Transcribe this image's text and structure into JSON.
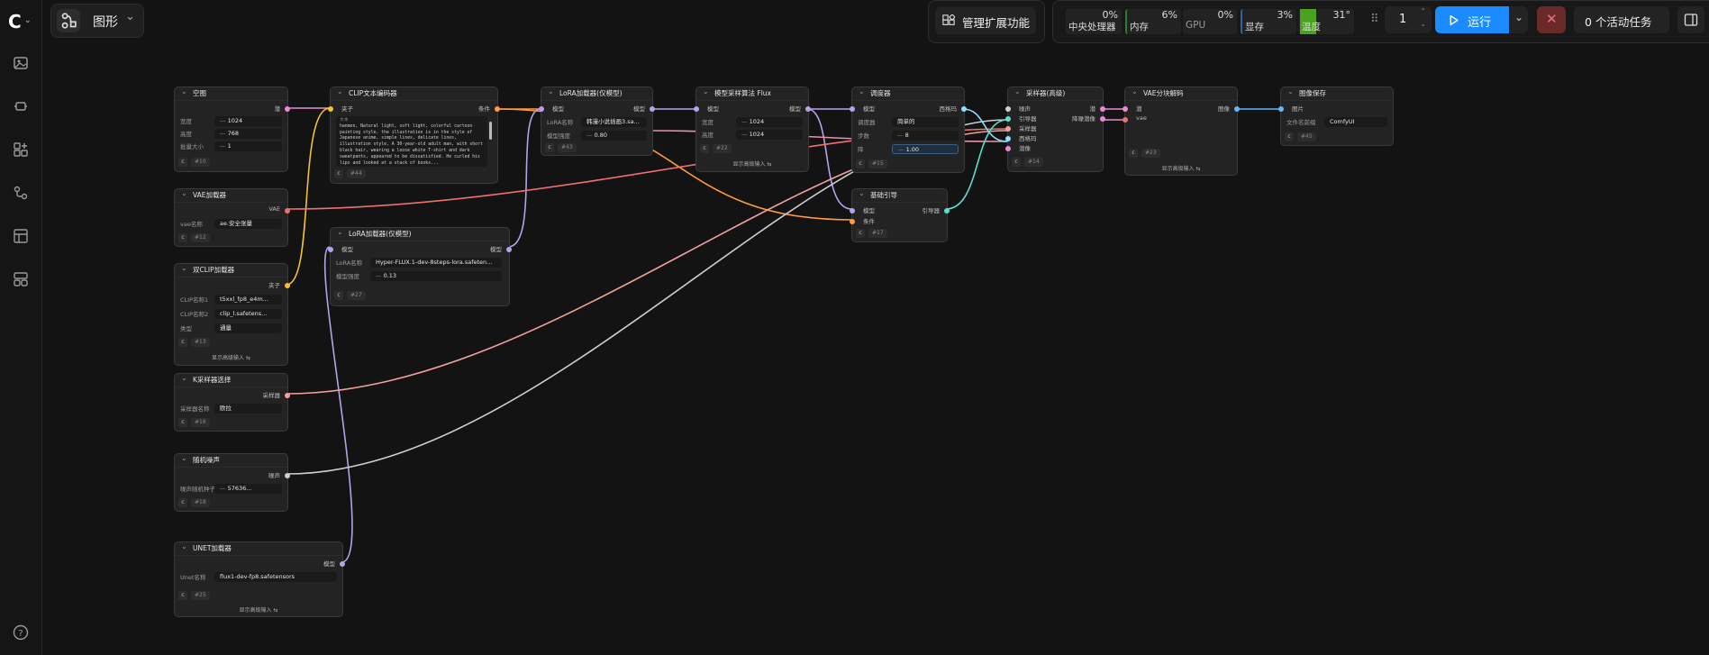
{
  "app": {
    "view_label": "图形"
  },
  "toolbar": {
    "extensions_label": "管理扩展功能",
    "run_label": "运行",
    "queue_count": "1",
    "active_tasks_label": "0 个活动任务"
  },
  "stats": [
    {
      "name": "中央处理器",
      "value": "0%"
    },
    {
      "name": "内存",
      "value": "6%"
    },
    {
      "name": "GPU",
      "value": "0%"
    },
    {
      "name": "显存",
      "value": "3%"
    },
    {
      "name": "温度",
      "value": "31°"
    }
  ],
  "colors": {
    "accent": "#1a8cff",
    "stop": "#6a2a2a",
    "temp_bar": "#4ca21e"
  },
  "nodes": {
    "empty_latent": {
      "title": "空图",
      "out": "潜",
      "width_label": "宽度",
      "width": "1024",
      "height_label": "高度",
      "height": "768",
      "batch_label": "批量大小",
      "batch": "1",
      "id": "#10"
    },
    "vae_loader": {
      "title": "VAE加载器",
      "out": "VAE",
      "vae_label": "vae名称",
      "vae_value": "ae.安全张量",
      "id": "#12"
    },
    "dual_clip": {
      "title": "双CLIP加载器",
      "out": "夹子",
      "clip1_label": "CLIP名称1",
      "clip1": "t5xxl_fp8_e4m...",
      "clip2_label": "CLIP名称2",
      "clip2": "clip_l.safetens...",
      "type_label": "类型",
      "type": "通量",
      "id": "#13",
      "link": "显示高级输入 ⇆"
    },
    "ksampler_select": {
      "title": "K采样器选择",
      "out": "采样器",
      "label": "采样器名称",
      "value": "欧拉",
      "id": "#16"
    },
    "random_noise": {
      "title": "随机噪声",
      "out": "噪声",
      "label": "噪声随机种子",
      "value": "57636...",
      "id": "#18"
    },
    "unet_loader": {
      "title": "UNET加载器",
      "out": "模型",
      "label": "Unet名称",
      "value": "flux1-dev-fp8.safetensors",
      "id": "#25",
      "link": "显示高级输入 ⇆"
    },
    "clip_text": {
      "title": "CLIP文本编码器",
      "in": "夹子",
      "out": "条件",
      "text": "hanmon, Natural light, soft light, colorful cartoon painting style, the illustration is in the style of Japanese anime, simple lines, delicate lines, illustration style, A 30-year-old adult man, with short black hair, wearing a loose white T-shirt and dark sweatpants, appeared to be dissatisfied. He curled his lips and looked at a stack of books...",
      "id": "#44",
      "text_prefix": "文本"
    },
    "lora_loader2": {
      "title": "LoRA加载器(仅模型)",
      "in": "模型",
      "out": "模型",
      "name_label": "LoRA名称",
      "name": "Hyper-FLUX.1-dev-8steps-lora.safeten...",
      "strength_label": "模型强度",
      "strength": "0.13",
      "id": "#27"
    },
    "lora_loader1": {
      "title": "LoRA加载器(仅模型)",
      "in": "模型",
      "out": "模型",
      "name_label": "LoRA名称",
      "name": "韩漫小说插画3.sa...",
      "strength_label": "模型强度",
      "strength": "0.80",
      "id": "#43"
    },
    "model_sampling": {
      "title": "模型采样算法 Flux",
      "in": "模型",
      "out": "模型",
      "w_label": "宽度",
      "w": "1024",
      "h_label": "高度",
      "h": "1024",
      "id": "#22",
      "link": "显示高级输入 ⇆"
    },
    "scheduler": {
      "title": "调度器",
      "in": "模型",
      "out": "西格玛",
      "sched_label": "调度器",
      "sched": "简单的",
      "steps_label": "步数",
      "steps": "8",
      "denoise_label": "降",
      "denoise": "1.00",
      "id": "#15"
    },
    "basic_guider": {
      "title": "基础引导",
      "in1": "模型",
      "in2": "条件",
      "out": "引导器",
      "id": "#17"
    },
    "custom_sampler": {
      "title": "采样器(高级)",
      "in_noise": "噪声",
      "in_guider": "引导器",
      "in_sampler": "采样器",
      "in_sigma": "西格玛",
      "in_latent": "潜像",
      "out1": "潜",
      "out2": "降噪潜像",
      "id": "#14"
    },
    "vae_decode": {
      "title": "VAE分块解码",
      "in1": "潜",
      "in2": "vae",
      "out": "图像",
      "id": "#23",
      "link": "显示高级输入 ⇆"
    },
    "save_image": {
      "title": "图像保存",
      "in": "图片",
      "label": "文件名前缀",
      "value": "ComfyUI",
      "id": "#45"
    }
  }
}
